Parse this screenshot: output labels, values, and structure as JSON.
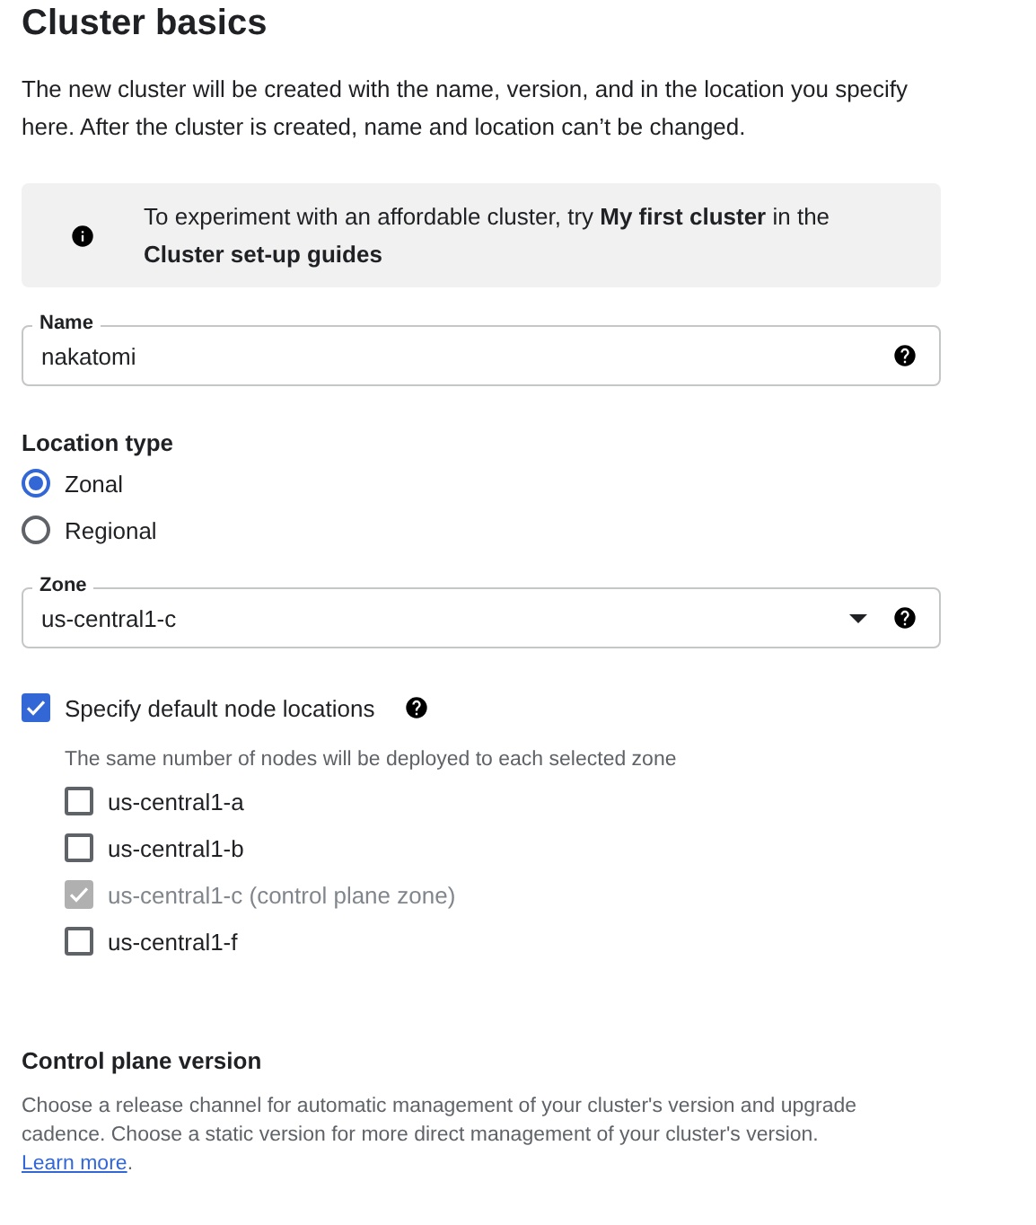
{
  "title": "Cluster basics",
  "description": "The new cluster will be created with the name, version, and in the location you specify here. After the cluster is created, name and location can’t be changed.",
  "info_banner": {
    "text": "To experiment with an affordable cluster, try **My first cluster** in the **Cluster set-up guides**"
  },
  "name_field": {
    "label": "Name",
    "value": "nakatomi"
  },
  "location_type": {
    "label": "Location type",
    "options": [
      {
        "label": "Zonal",
        "selected": true
      },
      {
        "label": "Regional",
        "selected": false
      }
    ]
  },
  "zone_field": {
    "label": "Zone",
    "value": "us-central1-c"
  },
  "default_node_locations": {
    "label": "Specify default node locations",
    "checked": true,
    "hint": "The same number of nodes will be deployed to each selected zone",
    "zones": [
      {
        "label": "us-central1-a",
        "checked": false,
        "disabled": false
      },
      {
        "label": "us-central1-b",
        "checked": false,
        "disabled": false
      },
      {
        "label": "us-central1-c (control plane zone)",
        "checked": true,
        "disabled": true
      },
      {
        "label": "us-central1-f",
        "checked": false,
        "disabled": false
      }
    ]
  },
  "control_plane_version": {
    "title": "Control plane version",
    "description": "Choose a release channel for automatic management of your cluster's version and upgrade cadence. Choose a static version for more direct management of your cluster's version.",
    "link": "Learn more",
    "after_link": "."
  }
}
